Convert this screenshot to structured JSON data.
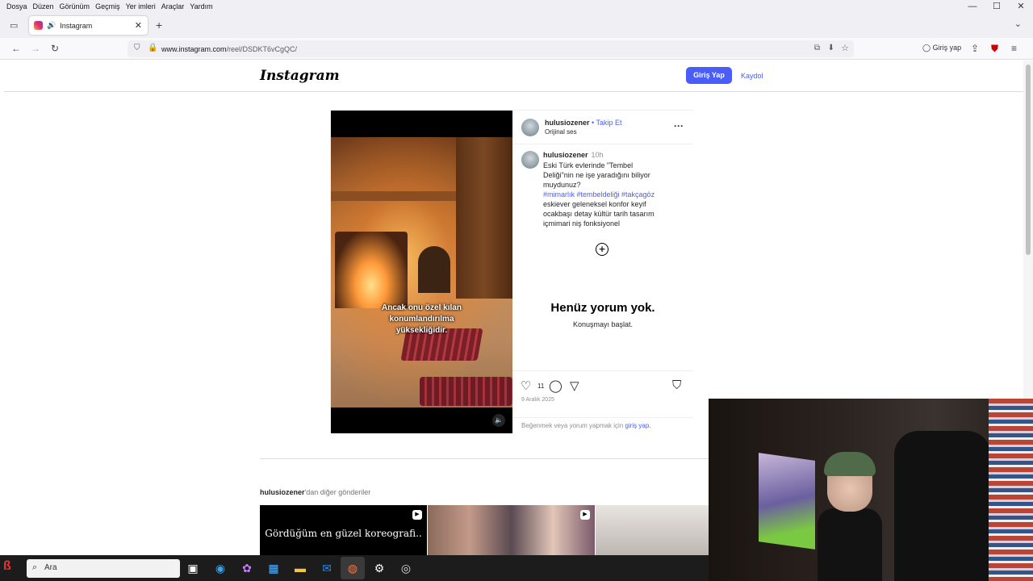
{
  "menu": [
    "Dosya",
    "Düzen",
    "Görünüm",
    "Geçmiş",
    "Yer imleri",
    "Araçlar",
    "Yardım"
  ],
  "tab": {
    "title": "Instagram"
  },
  "url": {
    "host": "www.instagram.com",
    "path": "/reel/DSDKT6vCgQC/"
  },
  "browser": {
    "login_label": "Giriş yap"
  },
  "header": {
    "logo": "Instagram",
    "login_button": "Giriş Yap",
    "signup_link": "Kaydol"
  },
  "reel": {
    "caption_overlay": "Ancak onu özel kılan konumlandırılma yüksekliğidir."
  },
  "post": {
    "username": "hulusiozener",
    "follow": "• Takip Et",
    "audio": "Orijinal ses",
    "caption_user": "hulusiozener",
    "caption_time": "10h",
    "caption_text": "Eski Türk evlerinde \"Tembel Deliği\"nin ne işe yaradığını biliyor muydunuz?",
    "caption_tags": "#mimarlık #tembeldeliği #takçagöz",
    "caption_keywords": "eskiever geleneksel konfor keyif ocakbaşı detay kültür tarih tasarım içmimari niş fonksiyonel",
    "no_comments_title": "Henüz yorum yok.",
    "no_comments_sub": "Konuşmayı başlat.",
    "likes": "11",
    "date": "9 Aralık 2025",
    "login_prompt_prefix": "Beğenmek veya yorum yapmak için ",
    "login_prompt_link": "giriş yap."
  },
  "more_posts": {
    "owner": "hulusiozener",
    "suffix": "'dan diğer gönderiler",
    "thumb1_text": "Gördüğüm en güzel koreografi.."
  },
  "taskbar": {
    "search_text": "Ara"
  },
  "colors": {
    "accent": "#4a5df9",
    "taskbar": "#1c1c1c"
  }
}
